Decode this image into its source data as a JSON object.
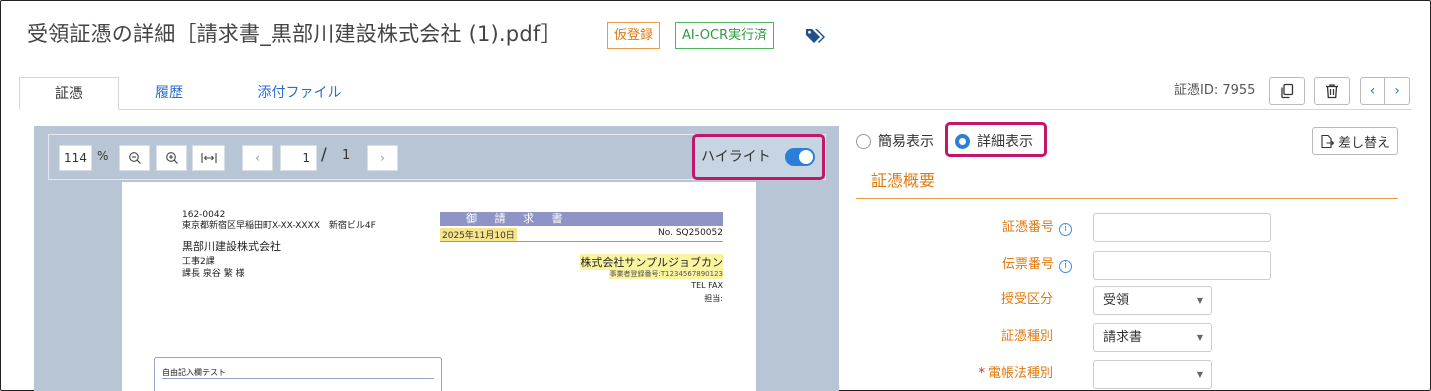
{
  "header": {
    "title": "受領証憑の詳細［請求書_黒部川建設株式会社 (1).pdf］",
    "badge_provisional": "仮登録",
    "badge_ocr": "AI-OCR実行済",
    "tag_icon": "tags-icon",
    "colors": {
      "provisional": "#e07a10",
      "ocr": "#2c9b3e",
      "highlight_frame": "#c2166a",
      "accent": "#2c7fd8"
    }
  },
  "tabs": [
    {
      "label": "証憑",
      "active": true
    },
    {
      "label": "履歴",
      "active": false
    },
    {
      "label": "添付ファイル",
      "active": false
    }
  ],
  "toolbar_right": {
    "voucher_id": "証憑ID: 7955",
    "copy_icon": "copy-icon",
    "trash_icon": "trash-icon",
    "prev": "‹",
    "next": "›"
  },
  "viewer": {
    "zoom": "114",
    "zoom_unit": "%",
    "page_current": "1",
    "page_sep": "/",
    "page_total": "1",
    "highlight_label": "ハイライト",
    "highlight_on": true
  },
  "document": {
    "postal": "162-0042",
    "address": "東京都新宿区早稲田町X-XX-XXXX　新宿ビル4F",
    "recipient_company": "黒部川建設株式会社",
    "dept": "工事2課",
    "person": "課長 泉谷 繁 様",
    "invoice_title": "御 請 求 書",
    "date": "2025年11月10日",
    "invoice_no": "No. SQ250052",
    "issuer": "株式会社サンプルジョブカン",
    "registration": "事業者登録番号:T1234567890123",
    "telfax": "TEL FAX",
    "tanto": "担当:",
    "memo_label": "自由記入欄テスト"
  },
  "panel": {
    "view_simple": "簡易表示",
    "view_detail": "詳細表示",
    "replace_button": "差し替え",
    "section_title": "証憑概要",
    "fields": {
      "voucher_no": {
        "label": "証憑番号",
        "value": ""
      },
      "slip_no": {
        "label": "伝票番号",
        "value": ""
      },
      "kubun": {
        "label": "授受区分",
        "value": "受領"
      },
      "kind": {
        "label": "証憑種別",
        "value": "請求書"
      },
      "denchou": {
        "label": "電帳法種別",
        "value": ""
      }
    },
    "info_glyph": "i",
    "required_mark": "*"
  }
}
